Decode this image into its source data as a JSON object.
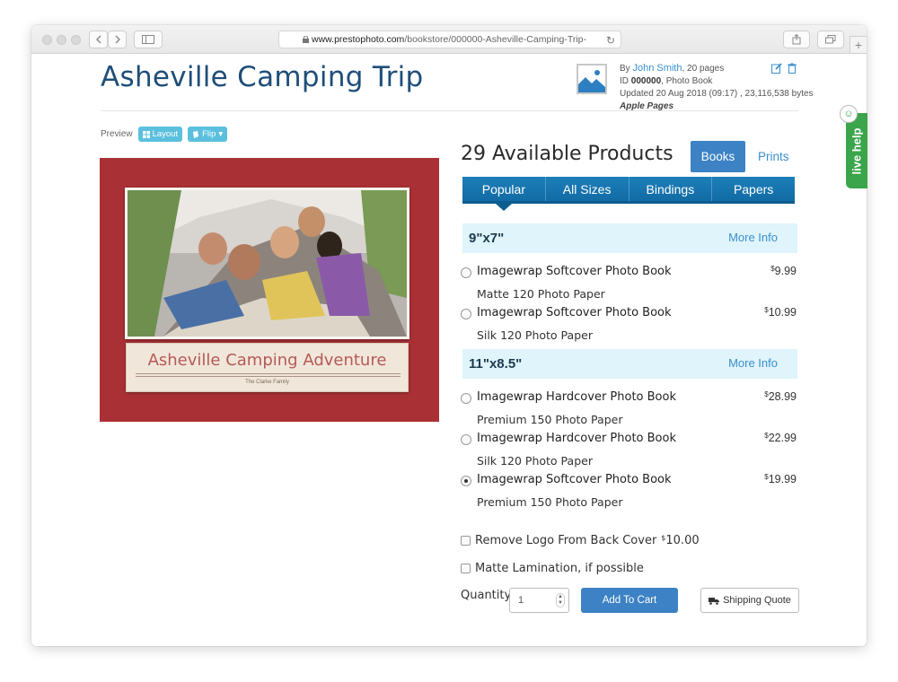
{
  "browser": {
    "url_host": "www.prestophoto.com",
    "url_path": "/bookstore/000000-Asheville-Camping-Trip-",
    "new_tab_label": "+"
  },
  "page": {
    "title": "Asheville Camping Trip"
  },
  "meta": {
    "by_label": "By",
    "author": "John Smith",
    "pages": ", 20 pages",
    "id_label": "ID",
    "id_value": "000000",
    "book_type": ", Photo Book",
    "updated": "Updated 20 Aug 2018 (09:17) , 23,116,538 bytes",
    "source": "Apple Pages"
  },
  "preview": {
    "label": "Preview",
    "layout_btn": "Layout",
    "flip_btn": "Flip"
  },
  "cover": {
    "title": "Asheville Camping Adventure",
    "subtitle": "The Clarke Family"
  },
  "products": {
    "heading": "29 Available Products",
    "books_btn": "Books",
    "prints_link": "Prints",
    "tabs": [
      "Popular",
      "All Sizes",
      "Bindings",
      "Papers"
    ],
    "groups": [
      {
        "size": "9\"x7\"",
        "more_info": "More Info",
        "items": [
          {
            "name": "Imagewrap Softcover Photo Book",
            "paper": "Matte 120 Photo Paper",
            "currency": "$",
            "price": "9.99",
            "selected": false
          },
          {
            "name": "Imagewrap Softcover Photo Book",
            "paper": "Silk 120 Photo Paper",
            "currency": "$",
            "price": "10.99",
            "selected": false
          }
        ]
      },
      {
        "size": "11\"x8.5\"",
        "more_info": "More Info",
        "items": [
          {
            "name": "Imagewrap Hardcover Photo Book",
            "paper": "Premium 150 Photo Paper",
            "currency": "$",
            "price": "28.99",
            "selected": false
          },
          {
            "name": "Imagewrap Hardcover Photo Book",
            "paper": "Silk 120 Photo Paper",
            "currency": "$",
            "price": "22.99",
            "selected": false
          },
          {
            "name": "Imagewrap Softcover Photo Book",
            "paper": "Premium 150 Photo Paper",
            "currency": "$",
            "price": "19.99",
            "selected": true
          }
        ]
      }
    ]
  },
  "options": {
    "remove_logo": "Remove Logo From Back Cover",
    "remove_logo_currency": "$",
    "remove_logo_price": "10.00",
    "matte_lamination": "Matte Lamination, if possible"
  },
  "cart": {
    "quantity_label": "Quantity",
    "quantity_value": "1",
    "add_to_cart": "Add To Cart",
    "shipping_quote": "Shipping Quote"
  },
  "live_help": {
    "label": "live help"
  },
  "colors": {
    "title_blue": "#1f4e79",
    "accent_blue": "#3c82c4",
    "tab_blue": "#1d7fba",
    "cover_red": "#a93135",
    "size_bar_bg": "#dff4fb",
    "live_help_green": "#3aa54a"
  }
}
